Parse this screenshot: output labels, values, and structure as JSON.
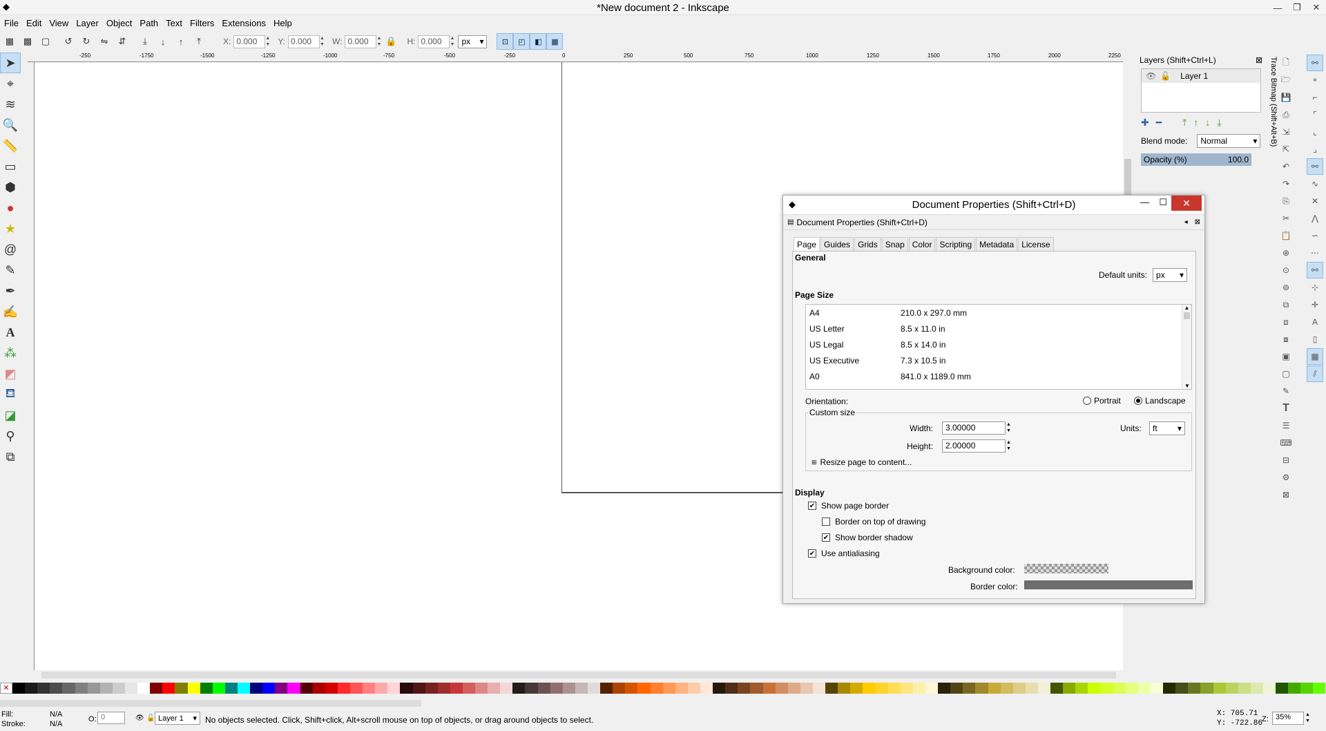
{
  "window": {
    "title": "*New document 2 - Inkscape"
  },
  "menu": [
    "File",
    "Edit",
    "View",
    "Layer",
    "Object",
    "Path",
    "Text",
    "Filters",
    "Extensions",
    "Help"
  ],
  "controls": {
    "x_label": "X:",
    "x": "0.000",
    "y_label": "Y:",
    "y": "0.000",
    "w_label": "W:",
    "w": "0.000",
    "h_label": "H:",
    "h": "0.000",
    "unit": "px"
  },
  "ruler_labels": [
    "-250",
    "-1750",
    "-1500",
    "-1250",
    "-1000",
    "-750",
    "-500",
    "-250",
    "0",
    "250",
    "500",
    "750",
    "1000",
    "1250",
    "1500",
    "1750",
    "2000",
    "2250"
  ],
  "layers": {
    "title": "Layers (Shift+Ctrl+L)",
    "layer_name": "Layer 1",
    "blend_label": "Blend mode:",
    "blend_value": "Normal",
    "opacity_label": "Opacity (%)",
    "opacity_value": "100.0"
  },
  "trace_bitmap_label": "Trace Bitmap (Shift+Alt+B)",
  "dialog": {
    "window_title": "Document Properties (Shift+Ctrl+D)",
    "docked_title": "Document Properties (Shift+Ctrl+D)",
    "tabs": [
      "Page",
      "Guides",
      "Grids",
      "Snap",
      "Color",
      "Scripting",
      "Metadata",
      "License"
    ],
    "general_title": "General",
    "default_units_label": "Default units:",
    "default_units": "px",
    "page_size_title": "Page Size",
    "page_sizes": [
      {
        "name": "A4",
        "size": "210.0 x 297.0 mm"
      },
      {
        "name": "US Letter",
        "size": "8.5 x 11.0 in"
      },
      {
        "name": "US Legal",
        "size": "8.5 x 14.0 in"
      },
      {
        "name": "US Executive",
        "size": "7.3 x 10.5 in"
      },
      {
        "name": "A0",
        "size": "841.0 x 1189.0 mm"
      }
    ],
    "orientation_label": "Orientation:",
    "portrait_label": "Portrait",
    "landscape_label": "Landscape",
    "custom_size_label": "Custom size",
    "width_label": "Width:",
    "width_value": "3.00000",
    "height_label": "Height:",
    "height_value": "2.00000",
    "units_label": "Units:",
    "units_value": "ft",
    "resize_label": "Resize page to content...",
    "display_title": "Display",
    "show_page_border": "Show page border",
    "border_on_top": "Border on top of drawing",
    "show_border_shadow": "Show border shadow",
    "use_antialiasing": "Use antialiasing",
    "background_color_label": "Background color:",
    "border_color_label": "Border color:"
  },
  "status": {
    "fill_label": "Fill:",
    "fill_value": "N/A",
    "stroke_label": "Stroke:",
    "stroke_value": "N/A",
    "opacity_label": "O:",
    "opacity_value": "0",
    "layer": "Layer 1",
    "message": "No objects selected. Click, Shift+click, Alt+scroll mouse on top of objects, or drag around objects to select.",
    "x": "X:  705.71",
    "y": "Y: -722.86",
    "zoom_label": "Z:",
    "zoom": "35%"
  },
  "palette": [
    "#000000",
    "#1a1a1a",
    "#333333",
    "#4d4d4d",
    "#666666",
    "#808080",
    "#999999",
    "#b3b3b3",
    "#cccccc",
    "#e6e6e6",
    "#ffffff",
    "#800000",
    "#ff0000",
    "#808000",
    "#ffff00",
    "#008000",
    "#00ff00",
    "#008080",
    "#00ffff",
    "#000080",
    "#0000ff",
    "#800080",
    "#ff00ff",
    "#550000",
    "#aa0000",
    "#d40000",
    "#ff2a2a",
    "#ff5555",
    "#ff8080",
    "#ffaaaa",
    "#ffd5d5",
    "#280b0b",
    "#501616",
    "#782121",
    "#a02c2c",
    "#c83737",
    "#d35f5f",
    "#de8787",
    "#e9afaf",
    "#f4d7d7",
    "#241c1c",
    "#483737",
    "#6c5353",
    "#916f6f",
    "#ac9393",
    "#c8b7b7",
    "#e3dbdb",
    "#552200",
    "#aa4400",
    "#d45500",
    "#ff6600",
    "#ff7f2a",
    "#ff9955",
    "#ffb380",
    "#ffccaa",
    "#ffe6d5",
    "#28170b",
    "#502d16",
    "#784421",
    "#a05a2c",
    "#c87137",
    "#d38d5f",
    "#deaa87",
    "#e9c6af",
    "#f4e3d7",
    "#554400",
    "#aa8800",
    "#d4aa00",
    "#ffcc00",
    "#ffd42a",
    "#ffdd55",
    "#ffe680",
    "#ffeeaa",
    "#fff6d5",
    "#282208",
    "#504416",
    "#786721",
    "#a0892c",
    "#c8ab37",
    "#d3bc5f",
    "#decd87",
    "#e9ddaf",
    "#f4eed7",
    "#445500",
    "#88aa00",
    "#aad400",
    "#ccff00",
    "#d4ff2a",
    "#ddff55",
    "#e5ff80",
    "#eeffaa",
    "#f6ffd5",
    "#222b00",
    "#445016",
    "#677821",
    "#89a02c",
    "#abc837",
    "#bcd35f",
    "#cdde87",
    "#dde9af",
    "#eef4d7",
    "#225500",
    "#44aa00",
    "#55d400",
    "#66ff00"
  ]
}
